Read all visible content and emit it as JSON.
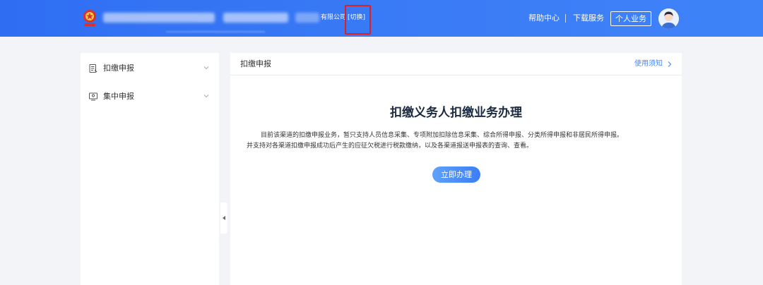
{
  "header": {
    "company_suffix": "有限公司",
    "switch_label": "[切换]",
    "help_label": "帮助中心",
    "download_label": "下载服务",
    "personal_label": "个人业务"
  },
  "sidebar": {
    "items": [
      {
        "label": "扣缴申报",
        "icon": "form-icon"
      },
      {
        "label": "集中申报",
        "icon": "monitor-icon"
      }
    ]
  },
  "main": {
    "title": "扣缴申报",
    "usage_link": "使用须知",
    "hero_title": "扣缴义务人扣缴业务办理",
    "description_line1": "目前该渠道的扣缴申报业务，暂只支持人员信息采集、专项附加扣除信息采集、综合所得申报、分类所得申报和非居民所得申报。",
    "description_line2": "并支持对各渠道扣缴申报成功后产生的应征欠税进行税款缴纳，以及各渠道报送申报表的查询、查看。",
    "action_button": "立即办理"
  },
  "colors": {
    "header_blue": "#2f6ef3",
    "link_blue": "#4a86f3",
    "highlight_red": "#e02020"
  }
}
